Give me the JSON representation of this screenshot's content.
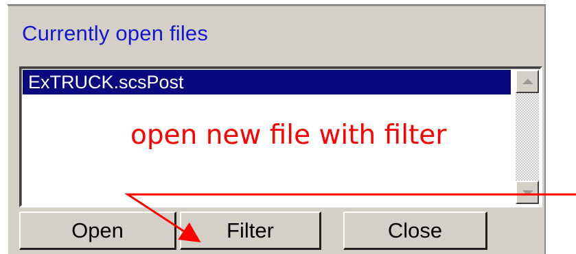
{
  "panel": {
    "title": "Currently open files",
    "files": [
      "ExTRUCK.scsPost"
    ],
    "buttons": {
      "open_label": "Open",
      "filter_label": "Filter",
      "close_label": "Close"
    }
  },
  "annotation": {
    "text": "open new file with filter",
    "color": "#ff0000"
  },
  "colors": {
    "title": "#1515d0",
    "selection": "#0a0a80",
    "panel_bg": "#d4d0c8"
  },
  "icons": {
    "scroll_up": "triangle-up-icon",
    "scroll_down": "triangle-down-icon"
  }
}
